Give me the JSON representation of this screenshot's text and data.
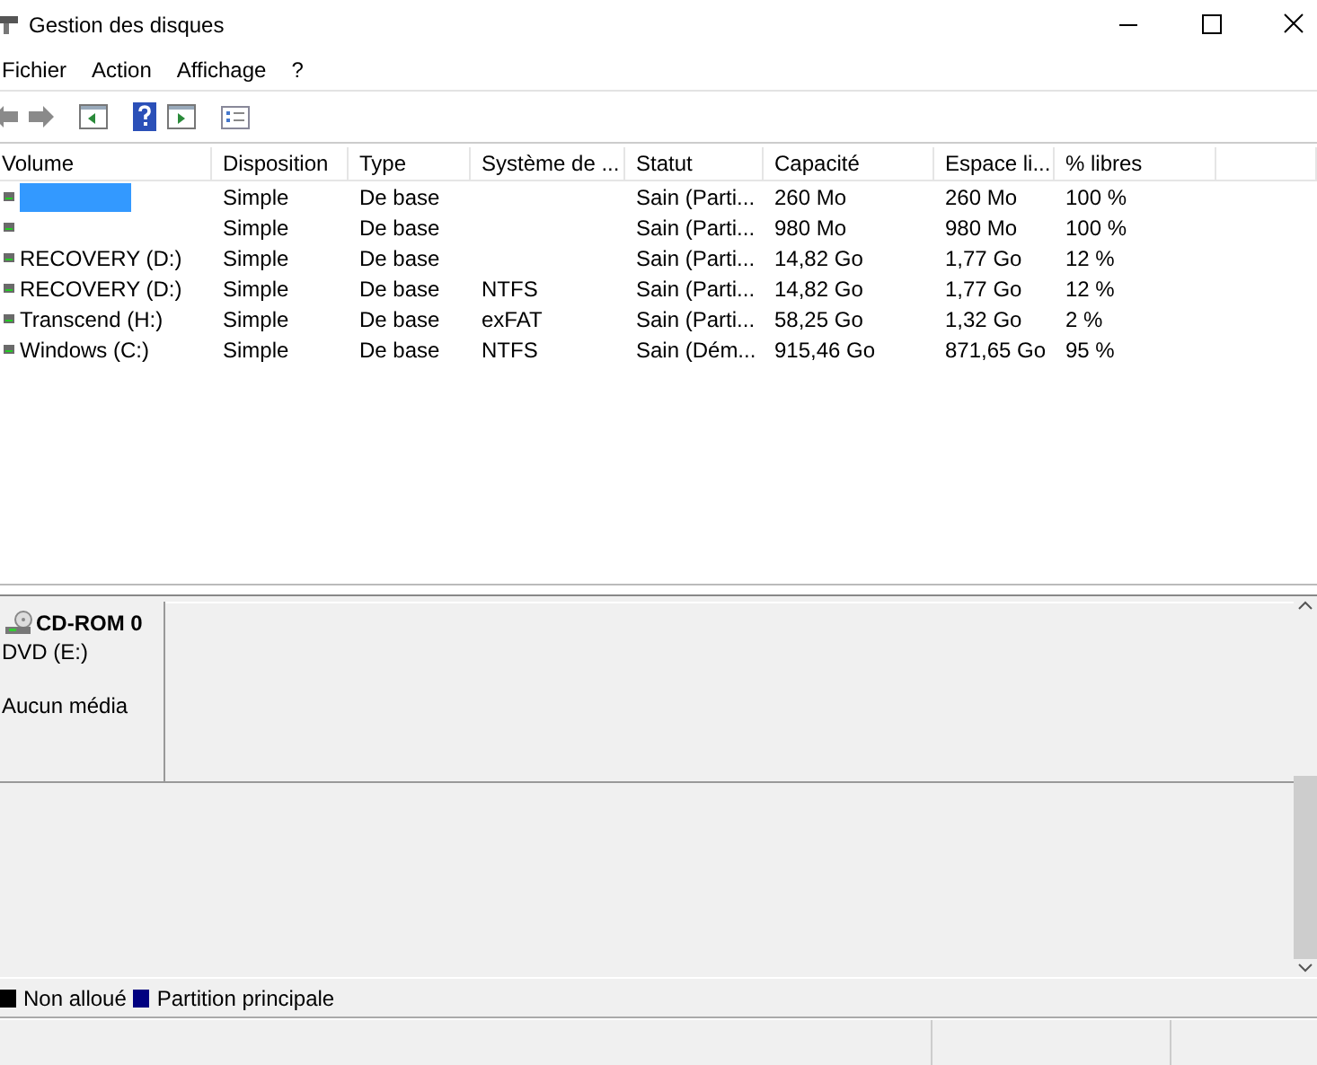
{
  "window": {
    "title": "Gestion des disques"
  },
  "menu": [
    "Fichier",
    "Action",
    "Affichage",
    "?"
  ],
  "toolbar": [
    {
      "kind": "back"
    },
    {
      "kind": "forward"
    },
    {
      "kind": "panel-left"
    },
    {
      "kind": "help"
    },
    {
      "kind": "panel-right"
    },
    {
      "kind": "list"
    }
  ],
  "table": {
    "columns": [
      "Volume",
      "Disposition",
      "Type",
      "Système de ...",
      "Statut",
      "Capacité",
      "Espace li...",
      "% libres"
    ],
    "rows": [
      {
        "selected": true,
        "cells": [
          "",
          "Simple",
          "De base",
          "",
          "Sain (Parti...",
          "260 Mo",
          "260 Mo",
          "100 %"
        ]
      },
      {
        "selected": false,
        "cells": [
          "",
          "Simple",
          "De base",
          "",
          "Sain (Parti...",
          "980 Mo",
          "980 Mo",
          "100 %"
        ]
      },
      {
        "selected": false,
        "cells": [
          "RECOVERY (D:)",
          "Simple",
          "De base",
          "",
          "Sain (Parti...",
          "14,82 Go",
          "1,77 Go",
          "12 %"
        ]
      },
      {
        "selected": false,
        "cells": [
          "RECOVERY (D:)",
          "Simple",
          "De base",
          "NTFS",
          "Sain (Parti...",
          "14,82 Go",
          "1,77 Go",
          "12 %"
        ]
      },
      {
        "selected": false,
        "cells": [
          "Transcend (H:)",
          "Simple",
          "De base",
          "exFAT",
          "Sain (Parti...",
          "58,25 Go",
          "1,32 Go",
          "2 %"
        ]
      },
      {
        "selected": false,
        "cells": [
          "Windows (C:)",
          "Simple",
          "De base",
          "NTFS",
          "Sain (Dém...",
          "915,46 Go",
          "871,65 Go",
          "95 %"
        ]
      }
    ]
  },
  "disks": [
    {
      "name": "CD-ROM 0",
      "drive": "DVD (E:)",
      "state": "Aucun média"
    }
  ],
  "legend": [
    {
      "label": "Non alloué",
      "color": "#000000"
    },
    {
      "label": "Partition principale",
      "color": "#000080"
    }
  ]
}
